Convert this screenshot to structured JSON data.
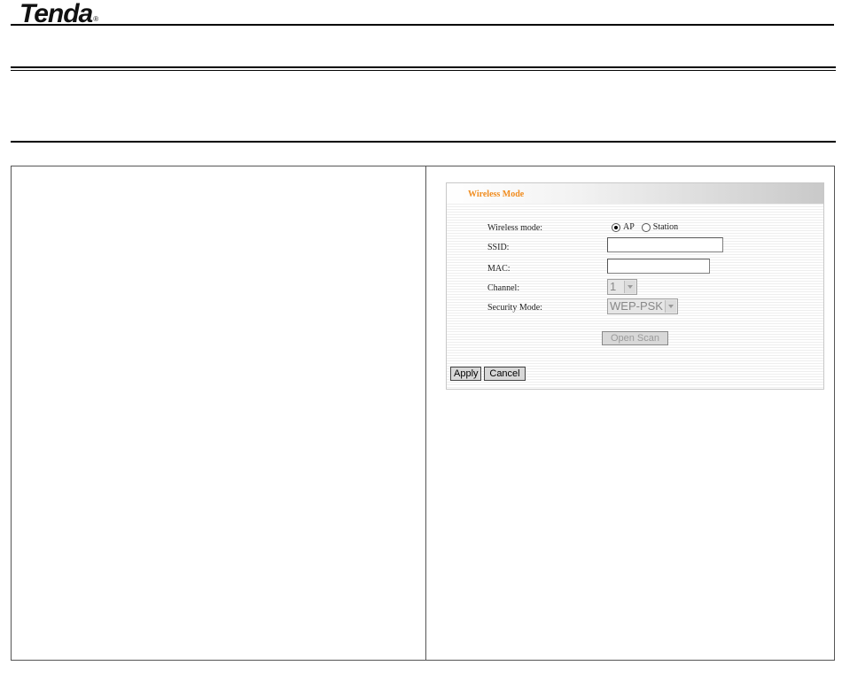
{
  "brand": {
    "name": "Tenda",
    "mark": "®"
  },
  "panel": {
    "title": "Wireless Mode",
    "fields": {
      "wireless_mode_label": "Wireless mode:",
      "ssid_label": "SSID:",
      "mac_label": "MAC:",
      "channel_label": "Channel:",
      "security_label": "Security Mode:"
    },
    "wireless_mode": {
      "options": [
        "AP",
        "Station"
      ],
      "selected": "AP"
    },
    "ssid_value": "",
    "mac_value": "",
    "channel_value": "1",
    "security_value": "WEP-PSK",
    "scan_button": "Open Scan",
    "apply_button": "Apply",
    "cancel_button": "Cancel"
  },
  "colors": {
    "title_accent": "#f08c1e"
  }
}
